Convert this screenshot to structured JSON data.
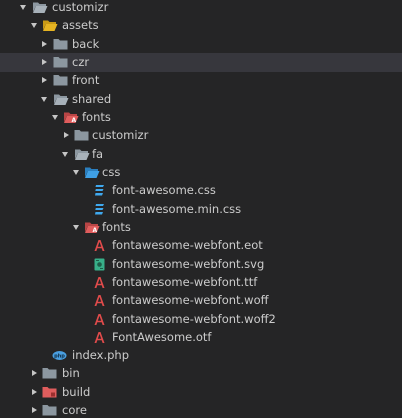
{
  "tree": {
    "items": [
      {
        "label": "customizr",
        "icon": "folder-open-icon",
        "expanded": true
      },
      {
        "label": "assets",
        "icon": "folder-open-icon-yellow",
        "expanded": true
      },
      {
        "label": "back",
        "icon": "folder-icon",
        "expanded": false
      },
      {
        "label": "czr",
        "icon": "folder-icon",
        "expanded": false,
        "selected": true
      },
      {
        "label": "front",
        "icon": "folder-icon",
        "expanded": false
      },
      {
        "label": "shared",
        "icon": "folder-open-icon",
        "expanded": true
      },
      {
        "label": "fonts",
        "icon": "fonts-folder-open-icon",
        "expanded": true
      },
      {
        "label": "customizr",
        "icon": "folder-icon",
        "expanded": false
      },
      {
        "label": "fa",
        "icon": "folder-open-icon",
        "expanded": true
      },
      {
        "label": "css",
        "icon": "css-folder-open-icon",
        "expanded": true
      },
      {
        "label": "font-awesome.css",
        "icon": "css-file-icon"
      },
      {
        "label": "font-awesome.min.css",
        "icon": "css-file-icon"
      },
      {
        "label": "fonts",
        "icon": "fonts-folder-open-icon",
        "expanded": true
      },
      {
        "label": "fontawesome-webfont.eot",
        "icon": "font-file-icon"
      },
      {
        "label": "fontawesome-webfont.svg",
        "icon": "svg-file-icon"
      },
      {
        "label": "fontawesome-webfont.ttf",
        "icon": "font-file-icon"
      },
      {
        "label": "fontawesome-webfont.woff",
        "icon": "font-file-icon"
      },
      {
        "label": "fontawesome-webfont.woff2",
        "icon": "font-file-icon"
      },
      {
        "label": "FontAwesome.otf",
        "icon": "font-file-icon"
      },
      {
        "label": "index.php",
        "icon": "php-file-icon"
      },
      {
        "label": "bin",
        "icon": "folder-icon",
        "expanded": false
      },
      {
        "label": "build",
        "icon": "build-folder-icon",
        "expanded": false
      },
      {
        "label": "core",
        "icon": "folder-icon",
        "expanded": false
      }
    ]
  },
  "colors": {
    "background": "#252526",
    "selected_row": "#37373d",
    "text": "#cccccc",
    "folder": "#8c97a0",
    "assets_folder": "#e6b422",
    "fonts_folder": "#e05d5d",
    "css_folder": "#3fa0e6",
    "css_file": "#3fa9ef",
    "font_file": "#e04b4b",
    "svg_file": "#38b089",
    "php_file": "#4a9fe0"
  }
}
